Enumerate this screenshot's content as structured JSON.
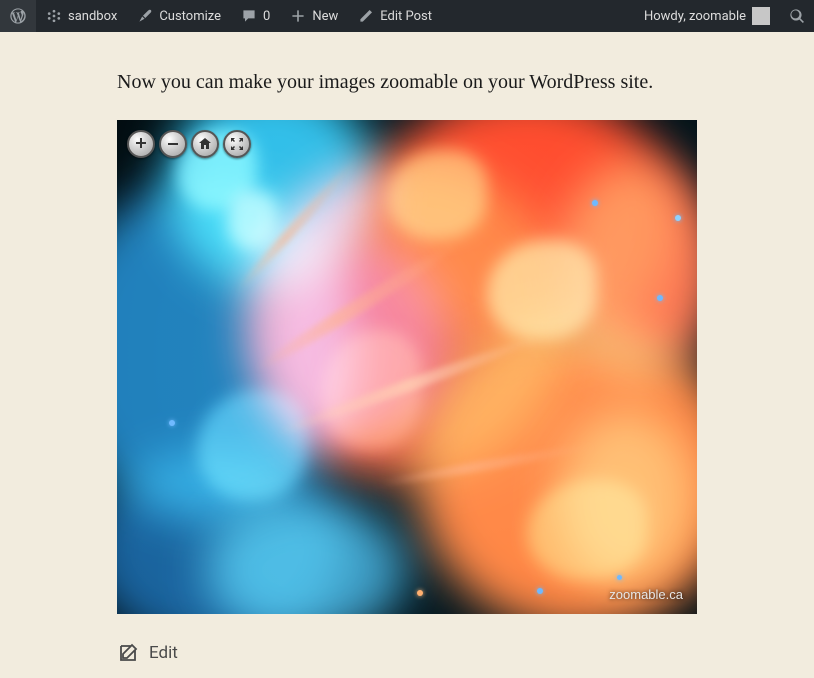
{
  "adminbar": {
    "wp_icon": "wordpress-icon",
    "site_name": "sandbox",
    "customize": "Customize",
    "comments_count": "0",
    "new": "New",
    "edit_post": "Edit Post",
    "howdy": "Howdy, zoomable"
  },
  "content": {
    "intro_text": "Now you can make your images zoomable on your WordPress site.",
    "watermark": "zoomable.ca",
    "edit_label": "Edit"
  },
  "viewer": {
    "toolbar": {
      "zoom_in": "Zoom in",
      "zoom_out": "Zoom out",
      "home": "Reset view",
      "fullpage": "Full page"
    }
  }
}
